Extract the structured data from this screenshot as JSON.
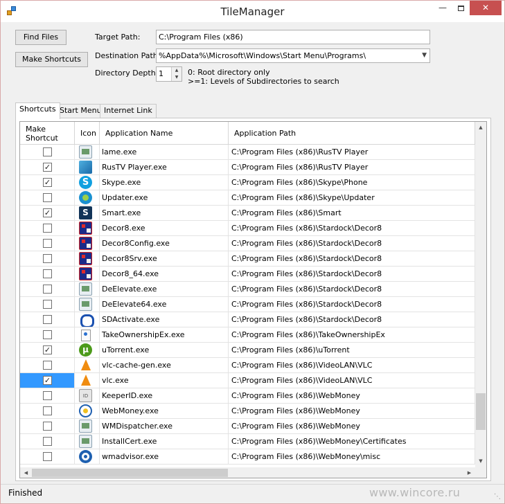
{
  "window": {
    "title": "TileManager"
  },
  "buttons": {
    "find_files": "Find Files",
    "make_shortcuts": "Make Shortcuts"
  },
  "fields": {
    "target_label": "Target Path:",
    "target_value": "C:\\Program Files (x86)",
    "destination_label": "Destination Path",
    "destination_value": "%AppData%\\Microsoft\\Windows\\Start Menu\\Programs\\",
    "depth_label": "Directory Depth",
    "depth_value": "1",
    "depth_help_line1": "0: Root directory only",
    "depth_help_line2": ">=1: Levels of Subdirectories to search"
  },
  "tabs": [
    "Shortcuts",
    "Start Menu",
    "Internet Link"
  ],
  "grid": {
    "columns": [
      "Make Shortcut",
      "Icon",
      "Application Name",
      "Application Path"
    ],
    "rows": [
      {
        "checked": false,
        "icon": "generic-app-icon",
        "name": "lame.exe",
        "path": "C:\\Program Files (x86)\\RusTV Player"
      },
      {
        "checked": true,
        "icon": "rustv-icon",
        "name": "RusTV Player.exe",
        "path": "C:\\Program Files (x86)\\RusTV Player"
      },
      {
        "checked": true,
        "icon": "skype-icon",
        "name": "Skype.exe",
        "path": "C:\\Program Files (x86)\\Skype\\Phone"
      },
      {
        "checked": false,
        "icon": "skype-updater-icon",
        "name": "Updater.exe",
        "path": "C:\\Program Files (x86)\\Skype\\Updater"
      },
      {
        "checked": true,
        "icon": "smart-icon",
        "name": "Smart.exe",
        "path": "C:\\Program Files (x86)\\Smart"
      },
      {
        "checked": false,
        "icon": "decor8-icon",
        "name": "Decor8.exe",
        "path": "C:\\Program Files (x86)\\Stardock\\Decor8"
      },
      {
        "checked": false,
        "icon": "decor8-icon",
        "name": "Decor8Config.exe",
        "path": "C:\\Program Files (x86)\\Stardock\\Decor8"
      },
      {
        "checked": false,
        "icon": "decor8-icon",
        "name": "Decor8Srv.exe",
        "path": "C:\\Program Files (x86)\\Stardock\\Decor8"
      },
      {
        "checked": false,
        "icon": "decor8-icon",
        "name": "Decor8_64.exe",
        "path": "C:\\Program Files (x86)\\Stardock\\Decor8"
      },
      {
        "checked": false,
        "icon": "generic-app-icon",
        "name": "DeElevate.exe",
        "path": "C:\\Program Files (x86)\\Stardock\\Decor8"
      },
      {
        "checked": false,
        "icon": "generic-app-icon",
        "name": "DeElevate64.exe",
        "path": "C:\\Program Files (x86)\\Stardock\\Decor8"
      },
      {
        "checked": false,
        "icon": "sdactivate-icon",
        "name": "SDActivate.exe",
        "path": "C:\\Program Files (x86)\\Stardock\\Decor8"
      },
      {
        "checked": false,
        "icon": "take-ownership-icon",
        "name": "TakeOwnershipEx.exe",
        "path": "C:\\Program Files (x86)\\TakeOwnershipEx"
      },
      {
        "checked": true,
        "icon": "utorrent-icon",
        "name": "uTorrent.exe",
        "path": "C:\\Program Files (x86)\\uTorrent"
      },
      {
        "checked": false,
        "icon": "vlc-icon",
        "name": "vlc-cache-gen.exe",
        "path": "C:\\Program Files (x86)\\VideoLAN\\VLC"
      },
      {
        "checked": true,
        "icon": "vlc-icon",
        "name": "vlc.exe",
        "path": "C:\\Program Files (x86)\\VideoLAN\\VLC",
        "selected": true
      },
      {
        "checked": false,
        "icon": "keeperid-icon",
        "name": "KeeperID.exe",
        "path": "C:\\Program Files (x86)\\WebMoney"
      },
      {
        "checked": false,
        "icon": "webmoney-icon",
        "name": "WebMoney.exe",
        "path": "C:\\Program Files (x86)\\WebMoney"
      },
      {
        "checked": false,
        "icon": "generic-app-icon",
        "name": "WMDispatcher.exe",
        "path": "C:\\Program Files (x86)\\WebMoney"
      },
      {
        "checked": false,
        "icon": "generic-app-icon",
        "name": "InstallCert.exe",
        "path": "C:\\Program Files (x86)\\WebMoney\\Certificates"
      },
      {
        "checked": false,
        "icon": "wmadvisor-icon",
        "name": "wmadvisor.exe",
        "path": "C:\\Program Files (x86)\\WebMoney\\misc"
      }
    ]
  },
  "status": {
    "text": "Finished",
    "watermark": "www.wincore.ru"
  },
  "colors": {
    "selection": "#3399ff",
    "close_button": "#c75050"
  }
}
